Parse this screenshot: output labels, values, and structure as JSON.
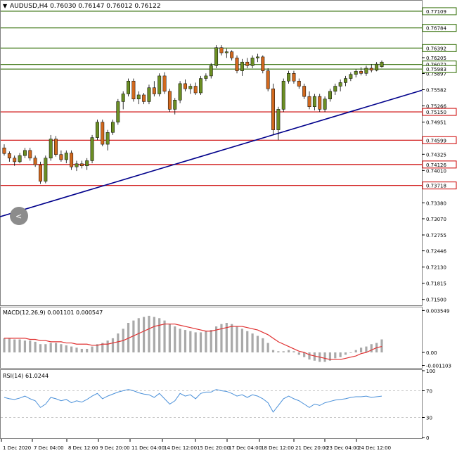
{
  "header": {
    "symbol_line": "AUDUSD,H4  0.76030 0.76147 0.76012 0.76122"
  },
  "colors": {
    "bull": "#6b8e23",
    "bear": "#d2691e",
    "green_level": "#2e6b00",
    "red_level": "#cc0000",
    "trendline": "#00008b",
    "macd_hist": "#a9a9a9",
    "macd_signal": "#e03030",
    "rsi_line": "#4a90d9",
    "grid": "#c8c8c8"
  },
  "chart_data": [
    {
      "type": "candlestick",
      "panel": "main",
      "price_axis_ticks": [
        "0.76392",
        "0.76205",
        "0.75897",
        "0.75582",
        "0.75266",
        "0.74951",
        "0.74325",
        "0.74010",
        "0.73695",
        "0.73380",
        "0.73070",
        "0.72755",
        "0.72446",
        "0.72130",
        "0.71815",
        "0.71500"
      ],
      "ylim": [
        0.714,
        0.773
      ],
      "levels_green": [
        "0.77109",
        "0.76784",
        "0.76392",
        "0.76072",
        "0.75983"
      ],
      "levels_red": [
        "0.75150",
        "0.74599",
        "0.74126",
        "0.73718"
      ],
      "trendline": {
        "from": [
          0,
          0.7311
        ],
        "to": [
          113,
          0.7557
        ]
      },
      "candles": [
        [
          0.7445,
          0.7452,
          0.743,
          0.7434
        ],
        [
          0.7434,
          0.7438,
          0.7418,
          0.7425
        ],
        [
          0.7425,
          0.743,
          0.741,
          0.7418
        ],
        [
          0.7418,
          0.7435,
          0.7415,
          0.743
        ],
        [
          0.743,
          0.7445,
          0.7425,
          0.744
        ],
        [
          0.744,
          0.7445,
          0.742,
          0.7425
        ],
        [
          0.7425,
          0.743,
          0.7408,
          0.7412
        ],
        [
          0.7412,
          0.7418,
          0.7375,
          0.738
        ],
        [
          0.738,
          0.743,
          0.7376,
          0.7425
        ],
        [
          0.7425,
          0.747,
          0.742,
          0.7462
        ],
        [
          0.7462,
          0.7468,
          0.7428,
          0.7432
        ],
        [
          0.7432,
          0.744,
          0.7418,
          0.7422
        ],
        [
          0.7422,
          0.744,
          0.7415,
          0.7435
        ],
        [
          0.7435,
          0.744,
          0.7402,
          0.7408
        ],
        [
          0.7408,
          0.742,
          0.74,
          0.7414
        ],
        [
          0.7414,
          0.742,
          0.7405,
          0.741
        ],
        [
          0.741,
          0.7425,
          0.7402,
          0.742
        ],
        [
          0.742,
          0.747,
          0.7415,
          0.7465
        ],
        [
          0.7465,
          0.75,
          0.746,
          0.7495
        ],
        [
          0.7495,
          0.75,
          0.7448,
          0.7452
        ],
        [
          0.7452,
          0.748,
          0.744,
          0.7475
        ],
        [
          0.7475,
          0.75,
          0.747,
          0.7495
        ],
        [
          0.7495,
          0.754,
          0.749,
          0.7535
        ],
        [
          0.7535,
          0.7555,
          0.752,
          0.755
        ],
        [
          0.755,
          0.758,
          0.7545,
          0.7575
        ],
        [
          0.7575,
          0.758,
          0.7535,
          0.754
        ],
        [
          0.754,
          0.7555,
          0.753,
          0.7548
        ],
        [
          0.7548,
          0.7552,
          0.753,
          0.7535
        ],
        [
          0.7535,
          0.7568,
          0.753,
          0.7562
        ],
        [
          0.7562,
          0.7575,
          0.7545,
          0.755
        ],
        [
          0.755,
          0.759,
          0.7545,
          0.7585
        ],
        [
          0.7585,
          0.7592,
          0.755,
          0.7555
        ],
        [
          0.7555,
          0.756,
          0.7515,
          0.752
        ],
        [
          0.752,
          0.7542,
          0.751,
          0.7538
        ],
        [
          0.7538,
          0.7575,
          0.7532,
          0.757
        ],
        [
          0.757,
          0.7578,
          0.7555,
          0.756
        ],
        [
          0.756,
          0.757,
          0.755,
          0.7565
        ],
        [
          0.7565,
          0.7572,
          0.7548,
          0.7552
        ],
        [
          0.7552,
          0.7585,
          0.7548,
          0.758
        ],
        [
          0.758,
          0.759,
          0.7575,
          0.7585
        ],
        [
          0.7585,
          0.761,
          0.758,
          0.7605
        ],
        [
          0.7605,
          0.7645,
          0.76,
          0.764
        ],
        [
          0.764,
          0.7645,
          0.7625,
          0.763
        ],
        [
          0.763,
          0.7638,
          0.762,
          0.7632
        ],
        [
          0.7632,
          0.7635,
          0.7615,
          0.762
        ],
        [
          0.762,
          0.7625,
          0.759,
          0.7595
        ],
        [
          0.7595,
          0.7618,
          0.7585,
          0.7612
        ],
        [
          0.7612,
          0.762,
          0.76,
          0.7605
        ],
        [
          0.7605,
          0.7625,
          0.76,
          0.762
        ],
        [
          0.762,
          0.7628,
          0.7612,
          0.7622
        ],
        [
          0.7622,
          0.7625,
          0.759,
          0.7595
        ],
        [
          0.7595,
          0.76,
          0.7555,
          0.756
        ],
        [
          0.756,
          0.757,
          0.747,
          0.748
        ],
        [
          0.748,
          0.7525,
          0.746,
          0.752
        ],
        [
          0.752,
          0.758,
          0.7515,
          0.7575
        ],
        [
          0.7575,
          0.7595,
          0.757,
          0.759
        ],
        [
          0.759,
          0.7595,
          0.757,
          0.7575
        ],
        [
          0.7575,
          0.758,
          0.756,
          0.7565
        ],
        [
          0.7565,
          0.757,
          0.754,
          0.7545
        ],
        [
          0.7545,
          0.7555,
          0.752,
          0.7525
        ],
        [
          0.7525,
          0.755,
          0.7518,
          0.7545
        ],
        [
          0.7545,
          0.755,
          0.7515,
          0.752
        ],
        [
          0.752,
          0.7545,
          0.7515,
          0.754
        ],
        [
          0.754,
          0.756,
          0.7535,
          0.7555
        ],
        [
          0.7555,
          0.757,
          0.7548,
          0.7565
        ],
        [
          0.7565,
          0.7578,
          0.7555,
          0.7572
        ],
        [
          0.7572,
          0.7585,
          0.7565,
          0.758
        ],
        [
          0.758,
          0.7592,
          0.7575,
          0.7588
        ],
        [
          0.7588,
          0.7598,
          0.7582,
          0.7594
        ],
        [
          0.7594,
          0.7602,
          0.7586,
          0.759
        ],
        [
          0.759,
          0.7605,
          0.7585,
          0.76
        ],
        [
          0.76,
          0.7608,
          0.7592,
          0.7596
        ],
        [
          0.7596,
          0.7612,
          0.7594,
          0.7608
        ],
        [
          0.7603,
          0.7615,
          0.7601,
          0.7612
        ]
      ]
    },
    {
      "type": "bar",
      "panel": "macd",
      "label": "MACD(12,26,9) 0.001101 0.000547",
      "axis_ticks": [
        "0.003549",
        "0.00",
        "-0.001103"
      ],
      "ylim": [
        -0.00125,
        0.00375
      ],
      "hist": [
        0.0012,
        0.0012,
        0.0011,
        0.0011,
        0.001,
        0.001,
        0.0009,
        0.0007,
        0.0007,
        0.0008,
        0.0008,
        0.0007,
        0.0006,
        0.0005,
        0.0004,
        0.0003,
        0.0003,
        0.0005,
        0.0007,
        0.0008,
        0.001,
        0.0012,
        0.0016,
        0.002,
        0.0025,
        0.0027,
        0.0029,
        0.003,
        0.0031,
        0.003,
        0.0029,
        0.0027,
        0.0024,
        0.0022,
        0.002,
        0.0019,
        0.0018,
        0.0017,
        0.0017,
        0.0018,
        0.0019,
        0.0022,
        0.0024,
        0.0025,
        0.0024,
        0.0022,
        0.002,
        0.0018,
        0.0016,
        0.0014,
        0.0012,
        0.0008,
        0.0002,
        0.0001,
        0.0001,
        0.0002,
        0.0001,
        -0.0002,
        -0.0004,
        -0.0006,
        -0.0007,
        -0.0008,
        -0.0008,
        -0.0007,
        -0.0005,
        -0.0004,
        -0.0002,
        0.0,
        0.0002,
        0.0004,
        0.0005,
        0.0007,
        0.0008,
        0.0011
      ],
      "signal": [
        0.0012,
        0.0012,
        0.0012,
        0.0012,
        0.0012,
        0.0011,
        0.0011,
        0.001,
        0.001,
        0.0009,
        0.0009,
        0.0009,
        0.0008,
        0.0008,
        0.0007,
        0.0007,
        0.0007,
        0.0006,
        0.0006,
        0.0007,
        0.0007,
        0.0008,
        0.0009,
        0.001,
        0.0012,
        0.0014,
        0.0016,
        0.0018,
        0.002,
        0.0022,
        0.0023,
        0.0024,
        0.0024,
        0.0024,
        0.0023,
        0.0022,
        0.0021,
        0.002,
        0.0019,
        0.0018,
        0.0018,
        0.0019,
        0.002,
        0.0021,
        0.0022,
        0.0022,
        0.0022,
        0.0021,
        0.002,
        0.0019,
        0.0017,
        0.0015,
        0.0012,
        0.0009,
        0.0007,
        0.0005,
        0.0003,
        0.0001,
        0.0,
        -0.0002,
        -0.0003,
        -0.0004,
        -0.0005,
        -0.0006,
        -0.0006,
        -0.0006,
        -0.0005,
        -0.0004,
        -0.0003,
        -0.0001,
        0.0,
        0.0002,
        0.0004,
        0.0005
      ]
    },
    {
      "type": "line",
      "panel": "rsi",
      "label": "RSI(14) 61.0244",
      "axis_ticks": [
        "100",
        "70",
        "30",
        "0"
      ],
      "ylim": [
        0,
        100
      ],
      "levels": [
        70,
        30
      ],
      "values": [
        60,
        58,
        57,
        59,
        62,
        58,
        55,
        45,
        50,
        60,
        58,
        55,
        57,
        52,
        55,
        53,
        57,
        62,
        66,
        58,
        62,
        65,
        68,
        70,
        72,
        70,
        67,
        65,
        64,
        60,
        66,
        58,
        50,
        55,
        66,
        62,
        64,
        58,
        66,
        68,
        68,
        72,
        70,
        69,
        66,
        62,
        64,
        60,
        64,
        62,
        58,
        52,
        38,
        48,
        58,
        62,
        58,
        55,
        50,
        45,
        50,
        48,
        52,
        54,
        56,
        57,
        58,
        60,
        61,
        61,
        62,
        60,
        61,
        62
      ],
      "x_ticks": [
        "1 Dec 2020",
        "7 Dec 04:00",
        "8 Dec 12:00",
        "9 Dec 20:00",
        "11 Dec 04:00",
        "14 Dec 12:00",
        "15 Dec 20:00",
        "17 Dec 04:00",
        "18 Dec 12:00",
        "21 Dec 20:00",
        "23 Dec 04:00",
        "24 Dec 12:00"
      ]
    }
  ]
}
